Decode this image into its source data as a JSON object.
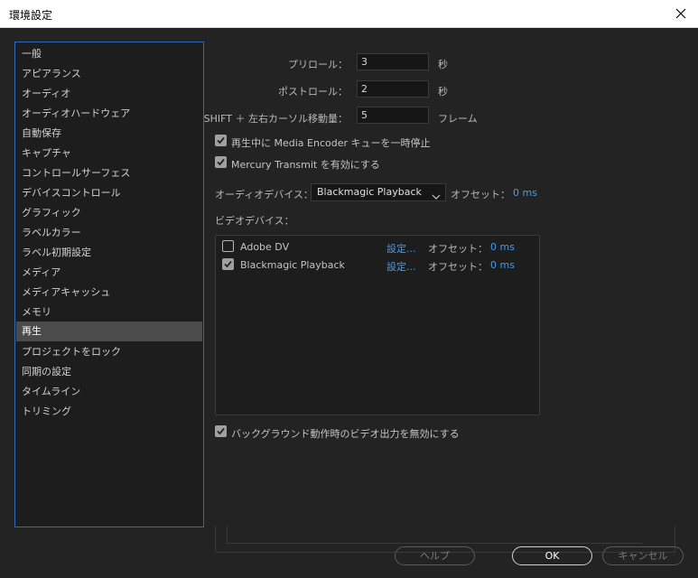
{
  "window": {
    "title": "環境設定"
  },
  "sidebar": {
    "items": [
      {
        "label": "一般"
      },
      {
        "label": "アピアランス"
      },
      {
        "label": "オーディオ"
      },
      {
        "label": "オーディオハードウェア"
      },
      {
        "label": "自動保存"
      },
      {
        "label": "キャプチャ"
      },
      {
        "label": "コントロールサーフェス"
      },
      {
        "label": "デバイスコントロール"
      },
      {
        "label": "グラフィック"
      },
      {
        "label": "ラベルカラー"
      },
      {
        "label": "ラベル初期設定"
      },
      {
        "label": "メディア"
      },
      {
        "label": "メディアキャッシュ"
      },
      {
        "label": "メモリ"
      },
      {
        "label": "再生"
      },
      {
        "label": "プロジェクトをロック"
      },
      {
        "label": "同期の設定"
      },
      {
        "label": "タイムライン"
      },
      {
        "label": "トリミング"
      }
    ],
    "selected": "再生"
  },
  "playback": {
    "preroll_label": "プリロール：",
    "preroll_value": "3",
    "preroll_unit": "秒",
    "postroll_label": "ポストロール：",
    "postroll_value": "2",
    "postroll_unit": "秒",
    "shift_label": "SHIFT ＋ 左右カーソル移動量：",
    "shift_value": "5",
    "shift_unit": "フレーム",
    "pause_me_label": "再生中に Media Encoder キューを一時停止",
    "pause_me_checked": true,
    "mercury_label": "Mercury Transmit を有効にする",
    "mercury_checked": true,
    "audio_device_label": "オーディオデバイス：",
    "audio_device_value": "Blackmagic Playback",
    "audio_offset_label": "オフセット：",
    "audio_offset_value": "0 ms",
    "video_device_label": "ビデオデバイス：",
    "video_devices": [
      {
        "name": "Adobe DV",
        "checked": false,
        "settings": "設定...",
        "offset_label": "オフセット：",
        "offset_value": "0 ms"
      },
      {
        "name": "Blackmagic Playback",
        "checked": true,
        "settings": "設定...",
        "offset_label": "オフセット：",
        "offset_value": "0 ms"
      }
    ],
    "disable_bg_label": "バックグラウンド動作時のビデオ出力を無効にする",
    "disable_bg_checked": true
  },
  "buttons": {
    "help": "ヘルプ",
    "ok": "OK",
    "cancel": "キャンセル"
  },
  "colors": {
    "accent": "#4a9be8",
    "selection": "#4b4b4b",
    "focus_border": "#2d6bb8"
  }
}
